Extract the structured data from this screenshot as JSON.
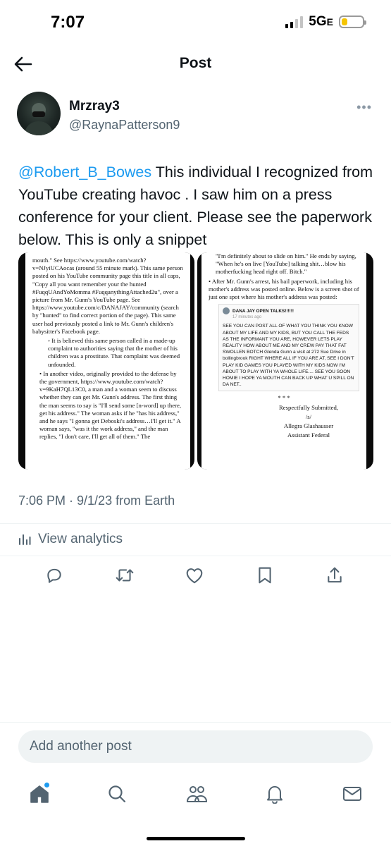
{
  "status_bar": {
    "time": "7:07",
    "network": "5G",
    "network_suffix": "E"
  },
  "header": {
    "title": "Post"
  },
  "post": {
    "author_name": "Mrzray3",
    "author_handle": "@RaynaPatterson9",
    "mention": "@Robert_B_Bowes",
    "text": " This individual I recognized from YouTube creating havoc . I saw him on a press conference for your client. Please see the paperwork below. This is only a snippet",
    "timestamp": "7:06 PM · 9/1/23 from Earth",
    "analytics_label": "View analytics"
  },
  "media": {
    "left_doc": [
      "mouth.\" See https://www.youtube.com/watch?v=NJyiUCAocas (around 55 minute mark). This same person posted on his YouTube community page this title in all caps, \"Copy all you want remember your the hunted #FuqqUAndYoMomma #FuqqanythingAttached2u\", over a picture from Mr. Gunn's YouTube page. See https://www.youtube.com/c/DANAJAY/community (search by \"hunted\" to find correct portion of the page). This same user had previously posted a link to Mr. Gunn's children's babysitter's Facebook page.",
      "◦ It is believed this same person called in a made-up complaint to authorities saying that the mother of his children was a prostitute. That complaint was deemed unfounded.",
      "• In another video, originally provided to the defense by the government, https://www.youtube.com/watch?v=9KaH7QL13C0, a man and a woman seem to discuss whether they can get Mr. Gunn's address. The first thing the man seems to say is \"I'll send some [n-word] up there, get his address.\" The woman asks if he \"has his address,\" and he says \"I gonna get Deboski's address…I'll get it.\" A woman says, \"was it the work address,\" and the man replies, \"I don't care, I'll get all of them.\" The"
    ],
    "right_doc": {
      "para1": "\"I'm definitely about to slide on him.\" He ends by saying, \"When he's on live [YouTube] talking shit…blow his motherfucking head right off. Bitch.\"",
      "para2": "• After Mr. Gunn's arrest, his bail paperwork, including his mother's address was posted online. Below is a screen shot of just one spot where his mother's address was posted:",
      "screenshot_name": "DANA JAY OPEN TALKS!!!!!!",
      "screenshot_time": "17 minutes ago",
      "screenshot_text": "SEE YOU CAN POST ALL OF WHAT YOU THINK YOU KNOW ABOUT MY LIFE AND MY KIDS, BUT YOU CALL THE FEDS AS THE INFORMANT YOU ARE, HOWEVER LETS PLAY REALITY HOW ABOUT ME AND MY CREW PAY THAT FAT SWOLLEN BOTCH Glenda Gunn a visit at 272 Sue Drive in bollingbrook  RIGHT WHERE ALL IF YOU ARE AT, SEE I DON'T PLAY KID GAMES YOU PLAYED WITH MY KIDS NOW I'M ABOUT TO PLAY WITH YA WHOLE LIFE.... SEE YOU SOON HOMIE I HOPE YA MOUTH CAN BACK UP WHAT U SPILL ON DA NET..",
      "stars": "*    *    *",
      "closing": "Respectfully Submitted,",
      "sig": "/s/",
      "signer": "Allegra Glashausser",
      "signer_title": "Assistant Federal"
    }
  },
  "reply": {
    "placeholder": "Add another post"
  },
  "colors": {
    "accent": "#1d9bf0",
    "secondary_text": "#536471",
    "battery": "#f5c400"
  },
  "icons": [
    "back-arrow-icon",
    "more-icon",
    "analytics-icon",
    "reply-icon",
    "repost-icon",
    "like-icon",
    "bookmark-icon",
    "share-icon",
    "home-icon",
    "search-icon",
    "communities-icon",
    "notifications-icon",
    "messages-icon"
  ]
}
